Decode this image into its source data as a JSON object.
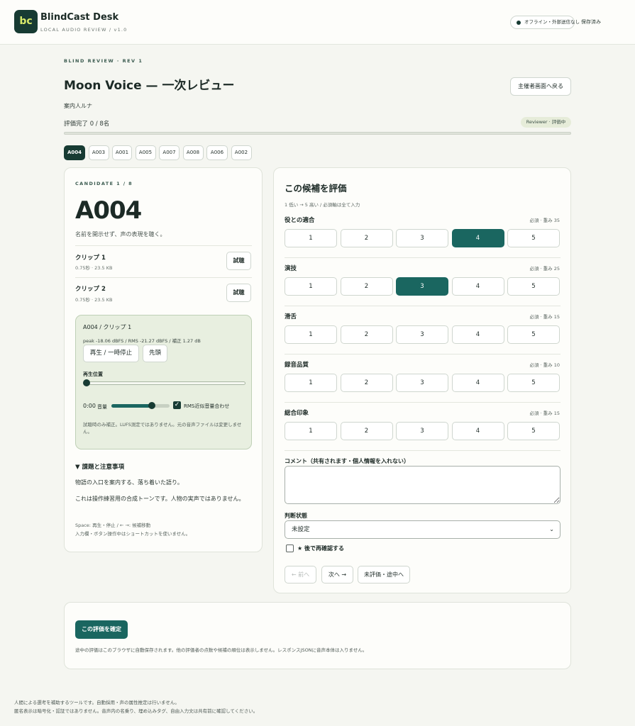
{
  "app": {
    "logo": "bc",
    "title": "BlindCast Desk",
    "subtitle": "LOCAL AUDIO REVIEW / v1.0",
    "offline_label": "オフライン・外部送信なし",
    "saved_label": "保存済み"
  },
  "header": {
    "eyebrow": "BLIND REVIEW · REV 1",
    "title": "Moon Voice — 一次レビュー",
    "back_label": "主催者画面へ戻る",
    "guide": "案内人ルナ",
    "progress_text": "評価完了 0 / 8名",
    "progress_fraction": 0,
    "role_badge": "Reviewer · 評価中"
  },
  "candidates": [
    {
      "id": "A004",
      "active": true
    },
    {
      "id": "A003",
      "active": false
    },
    {
      "id": "A001",
      "active": false
    },
    {
      "id": "A005",
      "active": false
    },
    {
      "id": "A007",
      "active": false
    },
    {
      "id": "A008",
      "active": false
    },
    {
      "id": "A006",
      "active": false
    },
    {
      "id": "A002",
      "active": false
    }
  ],
  "candidate": {
    "eyebrow": "CANDIDATE 1 / 8",
    "id": "A004",
    "note": "名前を開示せず、声の表現を聴く。",
    "clips": [
      {
        "name": "クリップ 1",
        "meta": "0.75秒 · 23.5 KB",
        "button": "試聴"
      },
      {
        "name": "クリップ 2",
        "meta": "0.75秒 · 23.5 KB",
        "button": "試聴"
      }
    ]
  },
  "player": {
    "title": "A004 / クリップ 1",
    "stats": "peak -18.06 dBFS / RMS -21.27 dBFS / 補正 1.27 dB",
    "play_label": "再生 / 一時停止",
    "rewind_label": "先頭",
    "position_label": "再生位置",
    "position_fraction": 0,
    "time": "0:00",
    "volume_label": "音量",
    "volume_fraction": 0.7,
    "rms_checked": true,
    "rms_label": "RMS近似音量合わせ",
    "note": "試聴時のみ補正。LUFS測定ではありません。元の音声ファイルは変更しません。"
  },
  "details": {
    "summary": "▼ 課題と注意事項",
    "lines": [
      "物語の入口を案内する、落ち着いた語り。",
      "これは操作練習用の合成トーンです。人物の実声ではありません。"
    ],
    "shortcuts": [
      "Space: 再生・停止 / ← →: 候補移動",
      "入力欄・ボタン操作中はショートカットを使いません。"
    ]
  },
  "rating": {
    "title": "この候補を評価",
    "hint": "1 低い → 5 高い / 必須軸は全て入力",
    "criteria": [
      {
        "name": "役との適合",
        "weight": "必須 · 重み 35",
        "selected": 4
      },
      {
        "name": "演技",
        "weight": "必須 · 重み 25",
        "selected": 3
      },
      {
        "name": "滑舌",
        "weight": "必須 · 重み 15",
        "selected": 0
      },
      {
        "name": "録音品質",
        "weight": "必須 · 重み 10",
        "selected": 0
      },
      {
        "name": "総合印象",
        "weight": "必須 · 重み 15",
        "selected": 0
      }
    ],
    "scores": [
      "1",
      "2",
      "3",
      "4",
      "5"
    ],
    "comment_label": "コメント（共有されます・個人情報を入れない）",
    "comment_value": "",
    "status_label": "判断状態",
    "status_value": "未設定",
    "recheck_checked": false,
    "recheck_label": "★ 後で再確認する",
    "prev_label": "← 前へ",
    "next_label": "次へ →",
    "unrated_label": "未評価・途中へ"
  },
  "confirm": {
    "button": "この評価を確定",
    "note": "途中の評価はこのブラウザに自動保存されます。他の評価者の点数や候補の順位は表示しません。レスポンスJSONに音声本体は入りません。"
  },
  "footer": {
    "lines": [
      "人間による選考を補助するツールです。自動採用・声の属性推定は行いません。",
      "匿名表示は暗号化・認証ではありません。音声内の名乗り、埋め込みタグ、自由入力文は共有前に確認してください。"
    ]
  },
  "colors": {
    "accent": "#1a6660",
    "brand_dark": "#173b33",
    "logo_text": "#d8e96a",
    "player_bg": "#e8efe0"
  }
}
